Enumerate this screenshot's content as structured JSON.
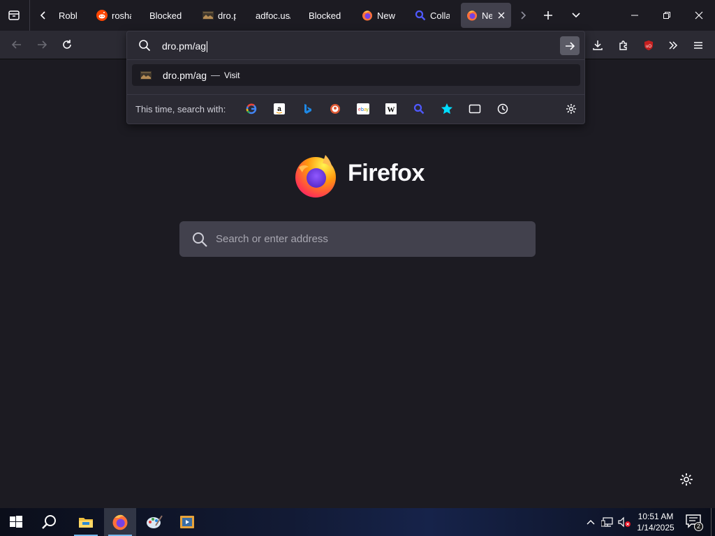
{
  "tabs": [
    {
      "label": "Roblo",
      "icon": "roblox-icon"
    },
    {
      "label": "rosha",
      "icon": "reddit-icon"
    },
    {
      "label": "Blocked",
      "icon": ""
    },
    {
      "label": "dro.p",
      "icon": "site-thumbnail-icon"
    },
    {
      "label": "adfoc.us/",
      "icon": ""
    },
    {
      "label": "Blocked",
      "icon": ""
    },
    {
      "label": "New",
      "icon": "firefox-icon"
    },
    {
      "label": "Colla",
      "icon": "search-icon"
    },
    {
      "label": "Ne",
      "icon": "firefox-icon",
      "active": true
    }
  ],
  "urlbar": {
    "value": "dro.pm/ag",
    "suggestion": {
      "text": "dro.pm/ag",
      "separator": "—",
      "action": "Visit"
    },
    "oneoff_label": "This time, search with:",
    "engines": [
      "google-icon",
      "amazon-icon",
      "bing-icon",
      "duckduckgo-icon",
      "ebay-icon",
      "wikipedia-icon",
      "search-icon",
      "bookmarks-star-icon",
      "tabs-icon",
      "history-icon"
    ]
  },
  "content": {
    "brand": "Firefox",
    "search_placeholder": "Search or enter address"
  },
  "taskbar": {
    "time": "10:51 AM",
    "date": "1/14/2025",
    "notification_count": "2"
  },
  "colors": {
    "background": "#1c1b22",
    "toolbar": "#2b2a33",
    "active_tab": "#42414d",
    "accent": "#76b9ed"
  }
}
